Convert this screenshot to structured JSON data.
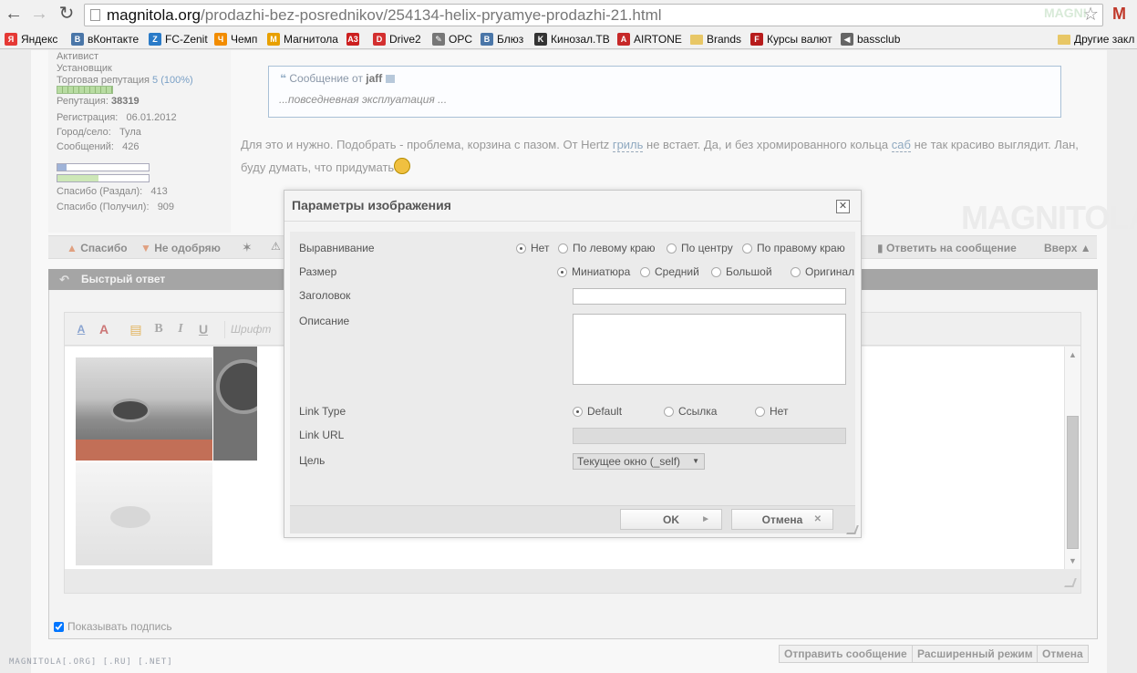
{
  "browser": {
    "url_host": "magnitola.org",
    "url_path": "/prodazhi-bez-posrednikov/254134-helix-pryamye-prodazhi-21.html",
    "extension_label": "MAGNI",
    "bookmarks": [
      {
        "label": "Яндекс",
        "icon": "yandex-icon",
        "color": "#e53935",
        "glyph": "Я"
      },
      {
        "label": "вКонтакте",
        "icon": "vk-icon",
        "color": "#4a76a8",
        "glyph": "В"
      },
      {
        "label": "FC-Zenit",
        "icon": "fc-zenit-icon",
        "color": "#2a7bc8",
        "glyph": "Z"
      },
      {
        "label": "Чемп",
        "icon": "champ-icon",
        "color": "#f28c00",
        "glyph": "Ч"
      },
      {
        "label": "Магнитола",
        "icon": "magnitola-icon",
        "color": "#e8a000",
        "glyph": "M"
      },
      {
        "label": "",
        "icon": "a3-icon",
        "color": "#cc1f1f",
        "glyph": "A3"
      },
      {
        "label": "Drive2",
        "icon": "drive2-icon",
        "color": "#d32f2f",
        "glyph": "D"
      },
      {
        "label": "OPC",
        "icon": "opc-icon",
        "color": "#777777",
        "glyph": "✎"
      },
      {
        "label": "Блюз",
        "icon": "vk-blues-icon",
        "color": "#4a76a8",
        "glyph": "В"
      },
      {
        "label": "Кинозал.ТВ",
        "icon": "kinozal-icon",
        "color": "#333333",
        "glyph": "K"
      },
      {
        "label": "AIRTONE",
        "icon": "airtone-icon",
        "color": "#c62828",
        "glyph": "A"
      },
      {
        "label": "Brands",
        "icon": "folder-icon",
        "color": "#e8c766",
        "glyph": ""
      },
      {
        "label": "Курсы валют",
        "icon": "currency-icon",
        "color": "#b71c1c",
        "glyph": "F"
      },
      {
        "label": "bassclub",
        "icon": "speaker-icon",
        "color": "#666666",
        "glyph": "◀"
      },
      {
        "label": "Другие закл",
        "icon": "folder-icon",
        "color": "#e8c766",
        "glyph": ""
      }
    ]
  },
  "user": {
    "rank1": "Активист",
    "rank2": "Установщик",
    "trade_rep_label": "Торговая репутация",
    "trade_rep_value": "5 (100%)",
    "rep_label": "Репутация:",
    "rep_value": "38319",
    "reg_label": "Регистрация:",
    "reg_value": "06.01.2012",
    "city_label": "Город/село:",
    "city_value": "Тула",
    "posts_label": "Сообщений:",
    "posts_value": "426",
    "thanks_section_label": "Спасибо (Раздал):",
    "thanks_section_value": "413",
    "thanks_got_label": "Спасибо (Получил):",
    "thanks_got_value": "909",
    "bar1_fill": 0.1,
    "bar2_fill": 0.45
  },
  "post": {
    "quote_from": "Сообщение от",
    "quote_author": "jaff",
    "quote_text": "...повседневная эксплуатация ...",
    "text_part1": "Для это и нужно. Подобрать - проблема, корзина с пазом. От Hertz ",
    "link1": "гриль",
    "text_part2": " не встает. Да, и без хромированного кольца ",
    "link2": "саб",
    "text_part3": " не так красиво выглядит. Лан, буду думать, что придумать",
    "watermark": "MAGNITOLA"
  },
  "actions": {
    "thanks": "Спасибо",
    "dislike": "Не одобряю",
    "reply": "Ответить на сообщение",
    "up": "Вверх"
  },
  "quick_reply": {
    "title": "Быстрый ответ",
    "font_placeholder": "Шрифт",
    "show_signature": "Показывать подпись",
    "btn_send": "Отправить сообщение",
    "btn_advanced": "Расширенный режим",
    "btn_cancel": "Отмена"
  },
  "footer_brand": "MAGNITOLA[.ORG] [.RU] [.NET]",
  "modal": {
    "title": "Параметры изображения",
    "align_label": "Выравнивание",
    "align_options": [
      "Нет",
      "По левому краю",
      "По центру",
      "По правому краю"
    ],
    "align_selected": "Нет",
    "size_label": "Размер",
    "size_options": [
      "Миниатюра",
      "Средний",
      "Большой",
      "Оригинал"
    ],
    "size_selected": "Миниатюра",
    "caption_label": "Заголовок",
    "caption_value": "",
    "description_label": "Описание",
    "description_value": "",
    "link_type_label": "Link Type",
    "link_type_options": [
      "Default",
      "Ссылка",
      "Нет"
    ],
    "link_type_selected": "Default",
    "link_url_label": "Link URL",
    "link_url_value": "",
    "target_label": "Цель",
    "target_value": "Текущее окно (_self)",
    "ok_label": "OK",
    "cancel_label": "Отмена"
  }
}
